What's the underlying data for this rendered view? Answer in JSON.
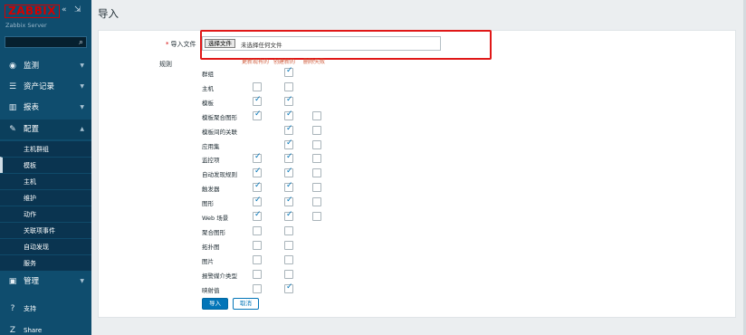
{
  "sidebar": {
    "brand": "ZABBIX",
    "server": "Zabbix Server",
    "collapse_glyph": "«",
    "kiosk_glyph": "⇲",
    "search_placeholder": "",
    "menus": [
      {
        "label": "监测",
        "icon": "eye-icon",
        "glyph": "◉"
      },
      {
        "label": "资产记录",
        "icon": "list-icon",
        "glyph": "☰"
      },
      {
        "label": "报表",
        "icon": "chart-icon",
        "glyph": "▥"
      },
      {
        "label": "配置",
        "icon": "wrench-icon",
        "glyph": "✎"
      },
      {
        "label": "管理",
        "icon": "admin-icon",
        "glyph": "▣"
      }
    ],
    "submenu": [
      "主机群组",
      "模板",
      "主机",
      "维护",
      "动作",
      "关联项事件",
      "自动发现",
      "服务"
    ],
    "footer": [
      {
        "label": "支持",
        "icon": "support-icon",
        "glyph": "?"
      },
      {
        "label": "Share",
        "icon": "share-icon",
        "glyph": "Z"
      }
    ]
  },
  "header": {
    "title": "导入"
  },
  "form": {
    "file_label": "导入文件",
    "file_button": "选择文件",
    "file_status": "未选择任何文件",
    "rules_label": "规则",
    "col_headers": [
      "更新现有的",
      "创建新的",
      "删除失败"
    ],
    "rules": [
      {
        "name": "群组",
        "checks": [
          null,
          true,
          null
        ]
      },
      {
        "name": "主机",
        "checks": [
          false,
          false,
          null
        ]
      },
      {
        "name": "模板",
        "checks": [
          true,
          true,
          null
        ]
      },
      {
        "name": "模板聚合图形",
        "checks": [
          true,
          true,
          false
        ]
      },
      {
        "name": "模板间的关联",
        "checks": [
          null,
          true,
          false
        ]
      },
      {
        "name": "应用集",
        "checks": [
          null,
          true,
          false
        ]
      },
      {
        "name": "监控项",
        "checks": [
          true,
          true,
          false
        ]
      },
      {
        "name": "自动发现规则",
        "checks": [
          true,
          true,
          false
        ]
      },
      {
        "name": "触发器",
        "checks": [
          true,
          true,
          false
        ]
      },
      {
        "name": "图形",
        "checks": [
          true,
          true,
          false
        ]
      },
      {
        "name": "Web 场景",
        "checks": [
          true,
          true,
          false
        ]
      },
      {
        "name": "聚合图形",
        "checks": [
          false,
          false,
          null
        ]
      },
      {
        "name": "拓扑图",
        "checks": [
          false,
          false,
          null
        ]
      },
      {
        "name": "图片",
        "checks": [
          false,
          false,
          null
        ]
      },
      {
        "name": "报警媒介类型",
        "checks": [
          false,
          false,
          null
        ]
      },
      {
        "name": "映射值",
        "checks": [
          false,
          true,
          null
        ]
      }
    ],
    "import_button": "导入",
    "cancel_button": "取消"
  },
  "colors": {
    "sidebar": "#0f4d6e",
    "brand": "#d40000",
    "accent": "#0275b8",
    "highlight": "#e01818"
  }
}
